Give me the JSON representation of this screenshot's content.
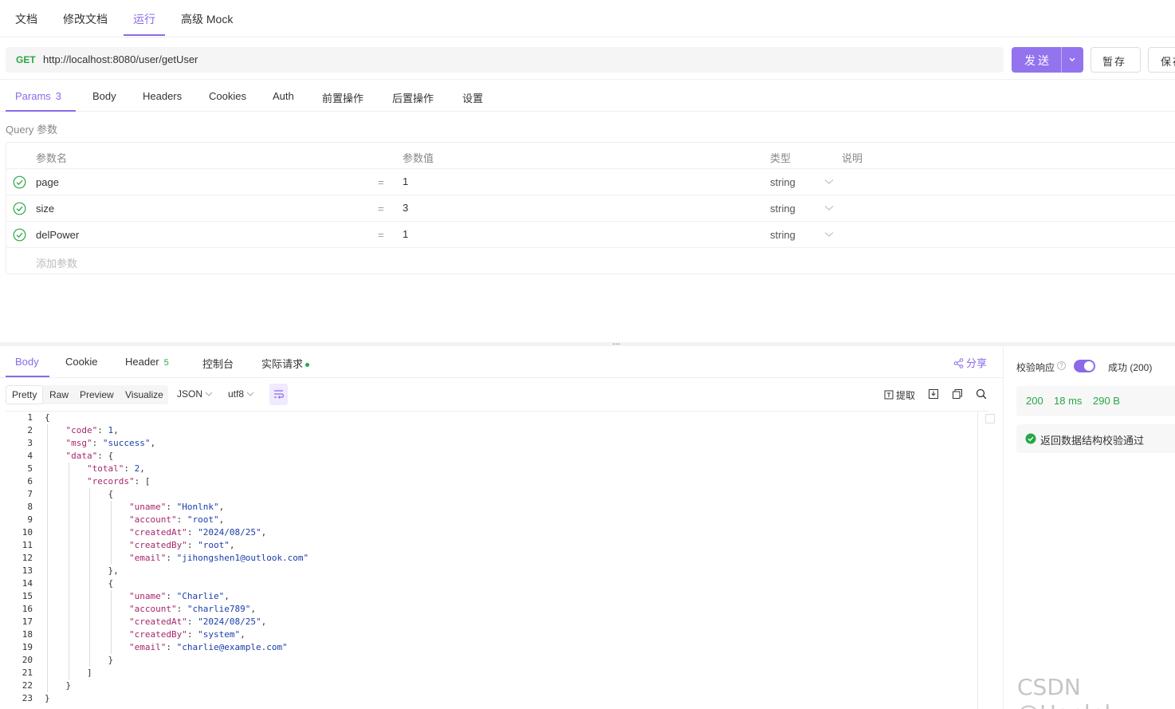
{
  "top_tabs": [
    {
      "label": "文档"
    },
    {
      "label": "修改文档"
    },
    {
      "label": "运行"
    },
    {
      "label": "高级 Mock"
    }
  ],
  "request": {
    "method": "GET",
    "url": "http://localhost:8080/user/getUser",
    "send_label": "发送",
    "save_temp_label": "暂存",
    "save_label": "保存"
  },
  "request_tabs": [
    {
      "label": "Params",
      "count": "3"
    },
    {
      "label": "Body"
    },
    {
      "label": "Headers"
    },
    {
      "label": "Cookies"
    },
    {
      "label": "Auth"
    },
    {
      "label": "前置操作"
    },
    {
      "label": "后置操作"
    },
    {
      "label": "设置"
    }
  ],
  "query": {
    "title": "Query 参数",
    "headers": {
      "name": "参数名",
      "value": "参数值",
      "type": "类型",
      "desc": "说明"
    },
    "rows": [
      {
        "name": "page",
        "eq": "=",
        "value": "1",
        "type": "string"
      },
      {
        "name": "size",
        "eq": "=",
        "value": "3",
        "type": "string"
      },
      {
        "name": "delPower",
        "eq": "=",
        "value": "1",
        "type": "string"
      }
    ],
    "add_placeholder": "添加参数"
  },
  "splitter": "...",
  "response_tabs": [
    {
      "label": "Body"
    },
    {
      "label": "Cookie"
    },
    {
      "label": "Header",
      "count": "5"
    },
    {
      "label": "控制台"
    },
    {
      "label": "实际请求"
    }
  ],
  "share_label": "分享",
  "view_modes": [
    "Pretty",
    "Raw",
    "Preview",
    "Visualize"
  ],
  "format_select": "JSON",
  "encoding_select": "utf8",
  "extract_label": "提取",
  "code_lines": [
    {
      "n": "1",
      "indent": 0,
      "text": "{"
    },
    {
      "n": "2",
      "indent": 1,
      "key": "code",
      "value": "1",
      "vtype": "n",
      "comma": true
    },
    {
      "n": "3",
      "indent": 1,
      "key": "msg",
      "value": "success",
      "vtype": "s",
      "comma": true
    },
    {
      "n": "4",
      "indent": 1,
      "key": "data",
      "open": "{"
    },
    {
      "n": "5",
      "indent": 2,
      "key": "total",
      "value": "2",
      "vtype": "n",
      "comma": true
    },
    {
      "n": "6",
      "indent": 2,
      "key": "records",
      "open": "["
    },
    {
      "n": "7",
      "indent": 3,
      "text": "{"
    },
    {
      "n": "8",
      "indent": 4,
      "key": "uname",
      "value": "Honlnk",
      "vtype": "s",
      "comma": true
    },
    {
      "n": "9",
      "indent": 4,
      "key": "account",
      "value": "root",
      "vtype": "s",
      "comma": true
    },
    {
      "n": "10",
      "indent": 4,
      "key": "createdAt",
      "value": "2024/08/25",
      "vtype": "s",
      "comma": true
    },
    {
      "n": "11",
      "indent": 4,
      "key": "createdBy",
      "value": "root",
      "vtype": "s",
      "comma": true
    },
    {
      "n": "12",
      "indent": 4,
      "key": "email",
      "value": "jihongshen1@outlook.com",
      "vtype": "s"
    },
    {
      "n": "13",
      "indent": 3,
      "text": "},"
    },
    {
      "n": "14",
      "indent": 3,
      "text": "{"
    },
    {
      "n": "15",
      "indent": 4,
      "key": "uname",
      "value": "Charlie",
      "vtype": "s",
      "comma": true
    },
    {
      "n": "16",
      "indent": 4,
      "key": "account",
      "value": "charlie789",
      "vtype": "s",
      "comma": true
    },
    {
      "n": "17",
      "indent": 4,
      "key": "createdAt",
      "value": "2024/08/25",
      "vtype": "s",
      "comma": true
    },
    {
      "n": "18",
      "indent": 4,
      "key": "createdBy",
      "value": "system",
      "vtype": "s",
      "comma": true
    },
    {
      "n": "19",
      "indent": 4,
      "key": "email",
      "value": "charlie@example.com",
      "vtype": "s"
    },
    {
      "n": "20",
      "indent": 3,
      "text": "}"
    },
    {
      "n": "21",
      "indent": 2,
      "text": "]"
    },
    {
      "n": "22",
      "indent": 1,
      "text": "}"
    },
    {
      "n": "23",
      "indent": 0,
      "text": "}"
    }
  ],
  "validation": {
    "title": "校验响应",
    "help": "?",
    "enabled": true,
    "status_text": "成功 (200)",
    "status_code": "200",
    "time": "18 ms",
    "size": "290 B",
    "message": "返回数据结构校验通过"
  },
  "watermark": "CSDN @Honlnk",
  "colors": {
    "accent": "#8a6ae8",
    "success": "#28a745",
    "send_button": "#9373ee"
  }
}
